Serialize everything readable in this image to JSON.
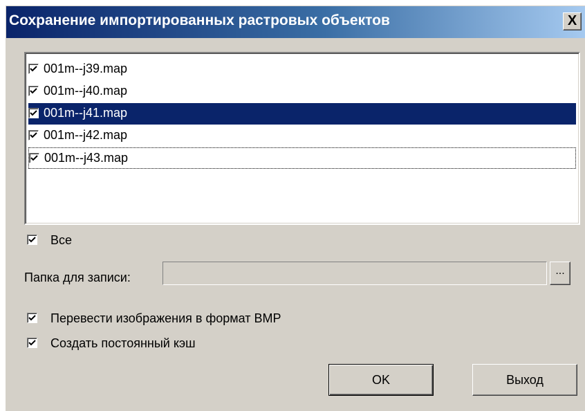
{
  "dialog": {
    "title": "Сохранение импортированных растровых объектов",
    "close_label": "X"
  },
  "files": [
    {
      "name": "001m--j39.map",
      "checked": true,
      "selected": false,
      "focused": false
    },
    {
      "name": "001m--j40.map",
      "checked": true,
      "selected": false,
      "focused": false
    },
    {
      "name": "001m--j41.map",
      "checked": true,
      "selected": true,
      "focused": false
    },
    {
      "name": "001m--j42.map",
      "checked": true,
      "selected": false,
      "focused": false
    },
    {
      "name": "001m--j43.map",
      "checked": true,
      "selected": false,
      "focused": true
    }
  ],
  "all_checkbox": {
    "label": "Все",
    "checked": true
  },
  "folder": {
    "label": "Папка для записи:",
    "value": "",
    "browse_label": "..."
  },
  "convert_bmp": {
    "label": "Перевести изображения в формат BMP",
    "checked": true
  },
  "create_cache": {
    "label": "Создать постоянный кэш",
    "checked": true
  },
  "buttons": {
    "ok": "OK",
    "exit": "Выход"
  },
  "colors": {
    "selection": "#0a246a",
    "face": "#d4d0c8",
    "title_start": "#0a246a",
    "title_end": "#a6caf0"
  }
}
